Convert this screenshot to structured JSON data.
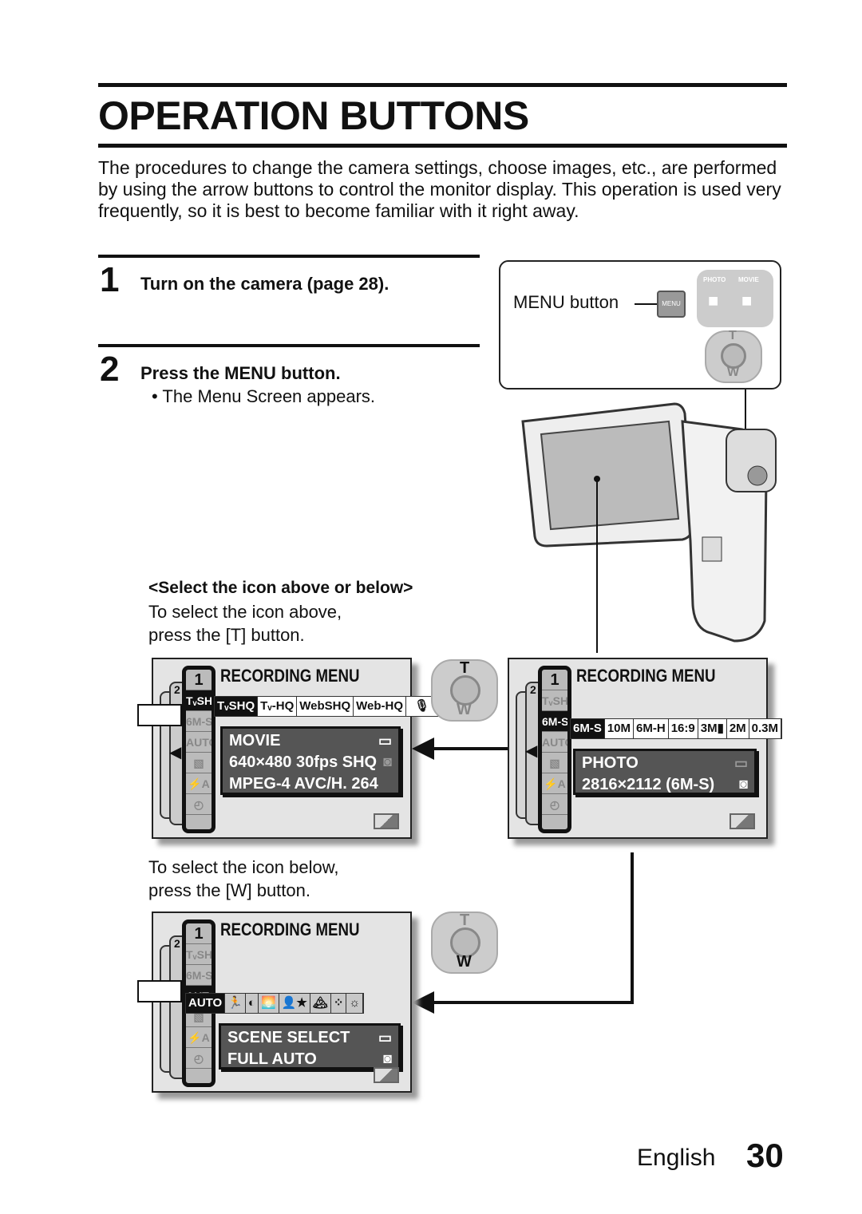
{
  "title": "OPERATION BUTTONS",
  "intro": "The procedures to change the camera settings, choose images, etc., are performed by using the arrow buttons to control the monitor display. This operation is used very frequently, so it is best to become familiar with it right away.",
  "steps": [
    {
      "num": "1",
      "heading": "Turn on the camera (page 28)."
    },
    {
      "num": "2",
      "heading": "Press the MENU button.",
      "bullet": "The Menu Screen appears."
    }
  ],
  "menu_box": {
    "label": "MENU button",
    "button_text": "MENU",
    "photo": "PHOTO",
    "movie": "MOVIE",
    "dial_t": "T",
    "dial_w": "W"
  },
  "select": {
    "heading": "<Select the icon above or below>",
    "above_1": "To select the icon above,",
    "above_2": "press the [T] button.",
    "below_1": "To select the icon below,",
    "below_2": "press the [W] button."
  },
  "screens": {
    "a": {
      "title": "RECORDING MENU",
      "tabs": [
        "1",
        "2"
      ],
      "column": [
        "TᵥSHQ",
        "6M-S",
        "AUTO",
        "▧",
        "⚡A",
        "◴"
      ],
      "row": [
        "TᵥSHQ",
        "Tᵥ-HQ",
        "WebSHQ",
        "Web-HQ",
        "🎙"
      ],
      "info": [
        "MOVIE",
        "640×480 30fps SHQ",
        "MPEG-4 AVC/H. 264"
      ]
    },
    "b": {
      "title": "RECORDING MENU",
      "tabs": [
        "1",
        "2"
      ],
      "column": [
        "TᵥSHQ",
        "6M-S",
        "AUTO",
        "▧",
        "⚡A",
        "◴"
      ],
      "row": [
        "6M-S",
        "10M",
        "6M-H",
        "16:9",
        "3M▮",
        "2M",
        "0.3M"
      ],
      "info": [
        "PHOTO",
        "2816×2112 (6M-S)"
      ]
    },
    "c": {
      "title": "RECORDING MENU",
      "tabs": [
        "1",
        "2"
      ],
      "column": [
        "TᵥSHQ",
        "6M-S",
        "AUTO",
        "▧",
        "⚡A",
        "◴"
      ],
      "row": [
        "AUTO",
        "🏃",
        "◐",
        "🌅",
        "👤★",
        "🏔",
        "⁘",
        "☼"
      ],
      "info": [
        "SCENE SELECT",
        "FULL AUTO"
      ]
    }
  },
  "dial": {
    "t": "T",
    "w": "W"
  },
  "footer": {
    "language": "English",
    "page": "30"
  }
}
